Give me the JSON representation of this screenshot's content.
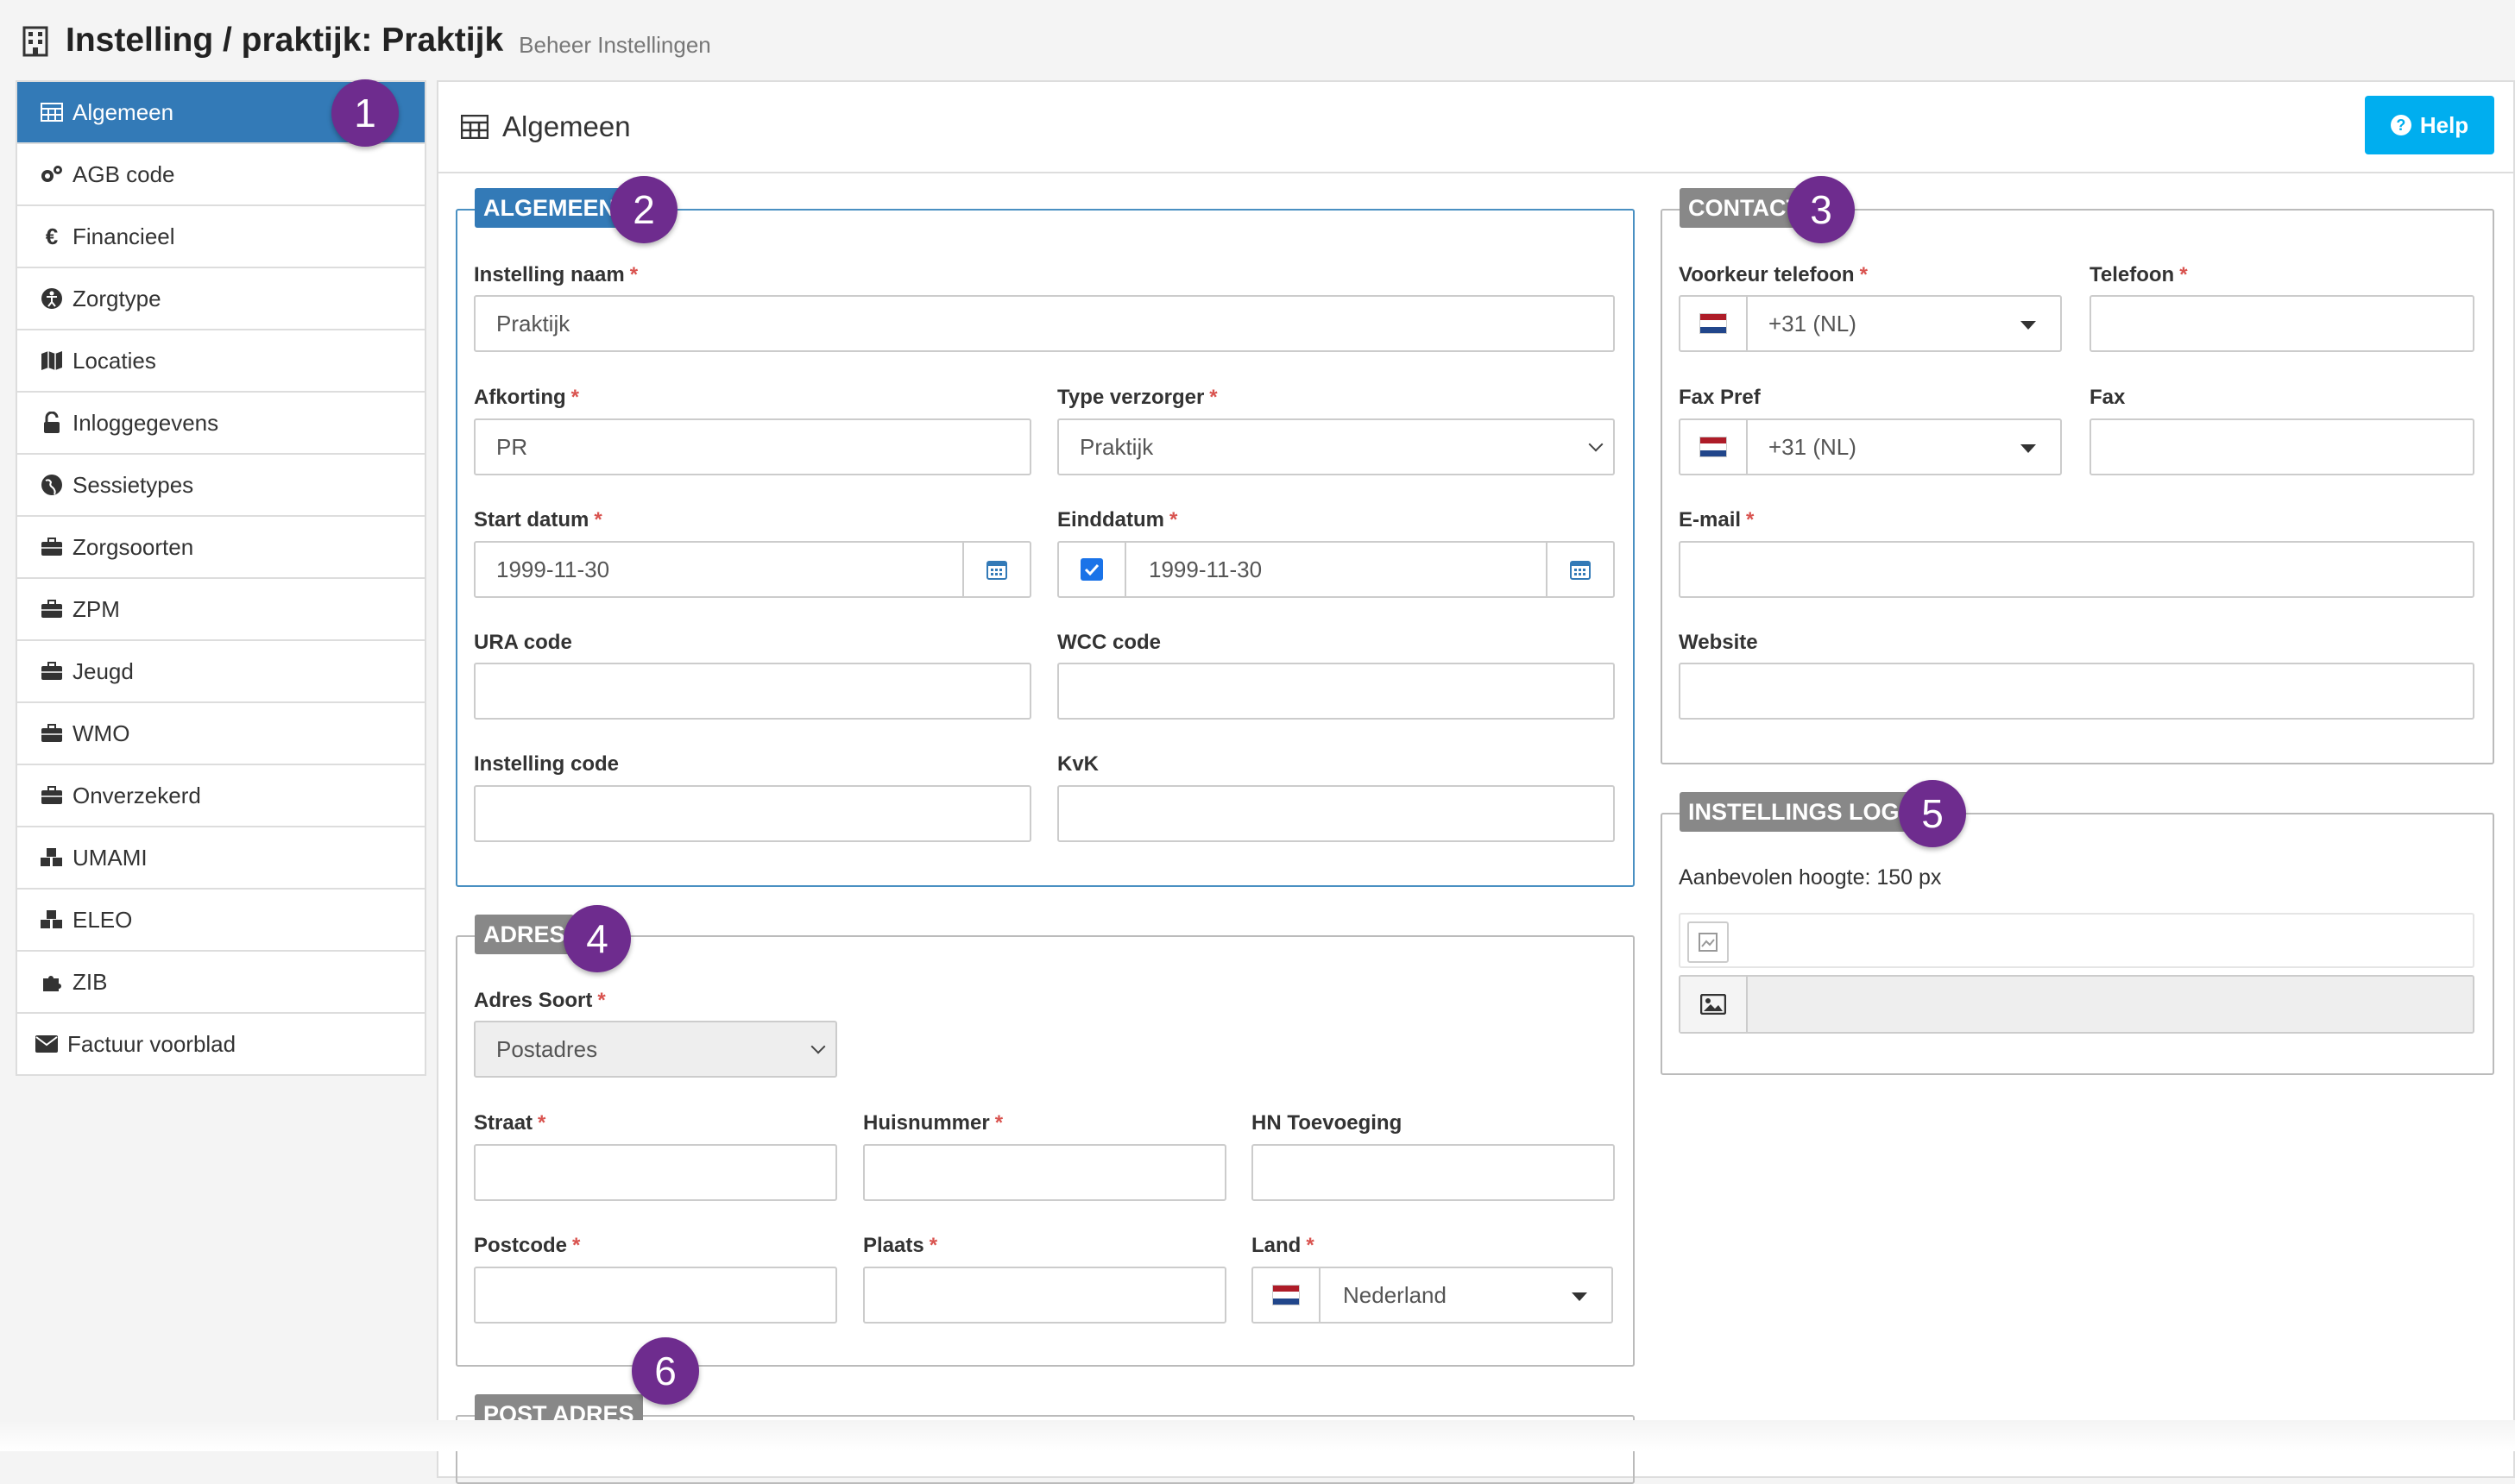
{
  "header": {
    "title": "Instelling / praktijk: Praktijk",
    "subtitle": "Beheer Instellingen"
  },
  "sidebar": {
    "items": [
      {
        "label": "Algemeen"
      },
      {
        "label": "AGB code"
      },
      {
        "label": "Financieel"
      },
      {
        "label": "Zorgtype"
      },
      {
        "label": "Locaties"
      },
      {
        "label": "Inloggegevens"
      },
      {
        "label": "Sessietypes"
      },
      {
        "label": "Zorgsoorten"
      },
      {
        "label": "ZPM"
      },
      {
        "label": "Jeugd"
      },
      {
        "label": "WMO"
      },
      {
        "label": "Onverzekerd"
      },
      {
        "label": "UMAMI"
      },
      {
        "label": "ELEO"
      },
      {
        "label": "ZIB"
      },
      {
        "label": "Factuur voorblad"
      }
    ]
  },
  "panel": {
    "title": "Algemeen",
    "help_label": "Help"
  },
  "algemeen": {
    "legend": "ALGEMEEN",
    "instelling_naam": {
      "label": "Instelling naam",
      "value": "Praktijk"
    },
    "afkorting": {
      "label": "Afkorting",
      "value": "PR"
    },
    "type_verzorger": {
      "label": "Type verzorger",
      "value": "Praktijk"
    },
    "start_datum": {
      "label": "Start datum",
      "value": "1999-11-30"
    },
    "einddatum": {
      "label": "Einddatum",
      "value": "1999-11-30"
    },
    "ura_code": {
      "label": "URA code",
      "value": ""
    },
    "wcc_code": {
      "label": "WCC code",
      "value": ""
    },
    "instelling_code": {
      "label": "Instelling code",
      "value": ""
    },
    "kvk": {
      "label": "KvK",
      "value": ""
    }
  },
  "contact": {
    "legend": "CONTACT",
    "voorkeur_telefoon": {
      "label": "Voorkeur telefoon",
      "value": "+31 (NL)"
    },
    "telefoon": {
      "label": "Telefoon",
      "value": ""
    },
    "fax_pref": {
      "label": "Fax Pref",
      "value": "+31 (NL)"
    },
    "fax": {
      "label": "Fax",
      "value": ""
    },
    "email": {
      "label": "E-mail",
      "value": ""
    },
    "website": {
      "label": "Website",
      "value": ""
    }
  },
  "logo": {
    "legend": "INSTELLINGS LOGO",
    "hint": "Aanbevolen hoogte: 150 px"
  },
  "adres": {
    "legend": "ADRES",
    "adres_soort": {
      "label": "Adres Soort",
      "value": "Postadres"
    },
    "straat": {
      "label": "Straat",
      "value": ""
    },
    "huisnummer": {
      "label": "Huisnummer",
      "value": ""
    },
    "hn_toevoeging": {
      "label": "HN Toevoeging",
      "value": ""
    },
    "postcode": {
      "label": "Postcode",
      "value": ""
    },
    "plaats": {
      "label": "Plaats",
      "value": ""
    },
    "land": {
      "label": "Land",
      "value": "Nederland"
    }
  },
  "post_adres": {
    "legend": "POST ADRES"
  },
  "badges": [
    "1",
    "2",
    "3",
    "4",
    "5",
    "6"
  ],
  "colors": {
    "primary": "#337ab7",
    "help": "#00aeef",
    "badge": "#6e2c8e",
    "required": "#d9534f"
  }
}
